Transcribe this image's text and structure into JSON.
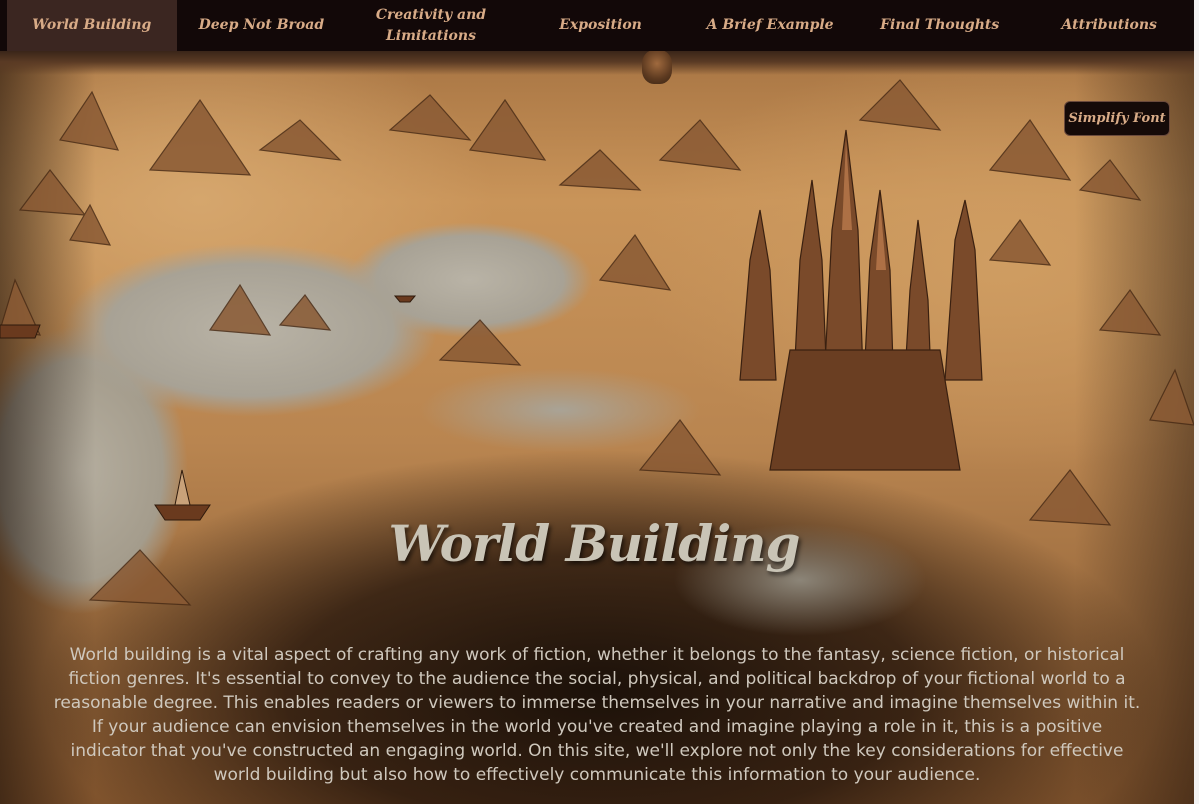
{
  "nav": {
    "items": [
      {
        "label": "World Building",
        "active": true
      },
      {
        "label": "Deep Not Broad",
        "active": false
      },
      {
        "label": "Creativity and Limitations",
        "active": false
      },
      {
        "label": "Exposition",
        "active": false
      },
      {
        "label": "A Brief Example",
        "active": false
      },
      {
        "label": "Final Thoughts",
        "active": false
      },
      {
        "label": "Attributions",
        "active": false
      }
    ]
  },
  "simplify_font_button": "Simplify Font",
  "hero": {
    "title": "World Building",
    "intro": "World building is a vital aspect of crafting any work of fiction, whether it belongs to the fantasy, science fiction, or historical fiction genres. It's essential to convey to the audience the social, physical, and political backdrop of your fictional world to a reasonable degree. This enables readers or viewers to immerse themselves in your narrative and imagine themselves within it. If your audience can envision themselves in the world you've created and imagine playing a role in it, this is a positive indicator that you've constructed an engaging world. On this site, we'll explore not only the key considerations for effective world building but also how to effectively communicate this information to your audience."
  },
  "colors": {
    "nav_background": "#120808",
    "nav_active_background": "#3b2621",
    "nav_text": "#d8ab87",
    "title_text": "#c9c4b6",
    "body_text": "#cfc8bd"
  }
}
